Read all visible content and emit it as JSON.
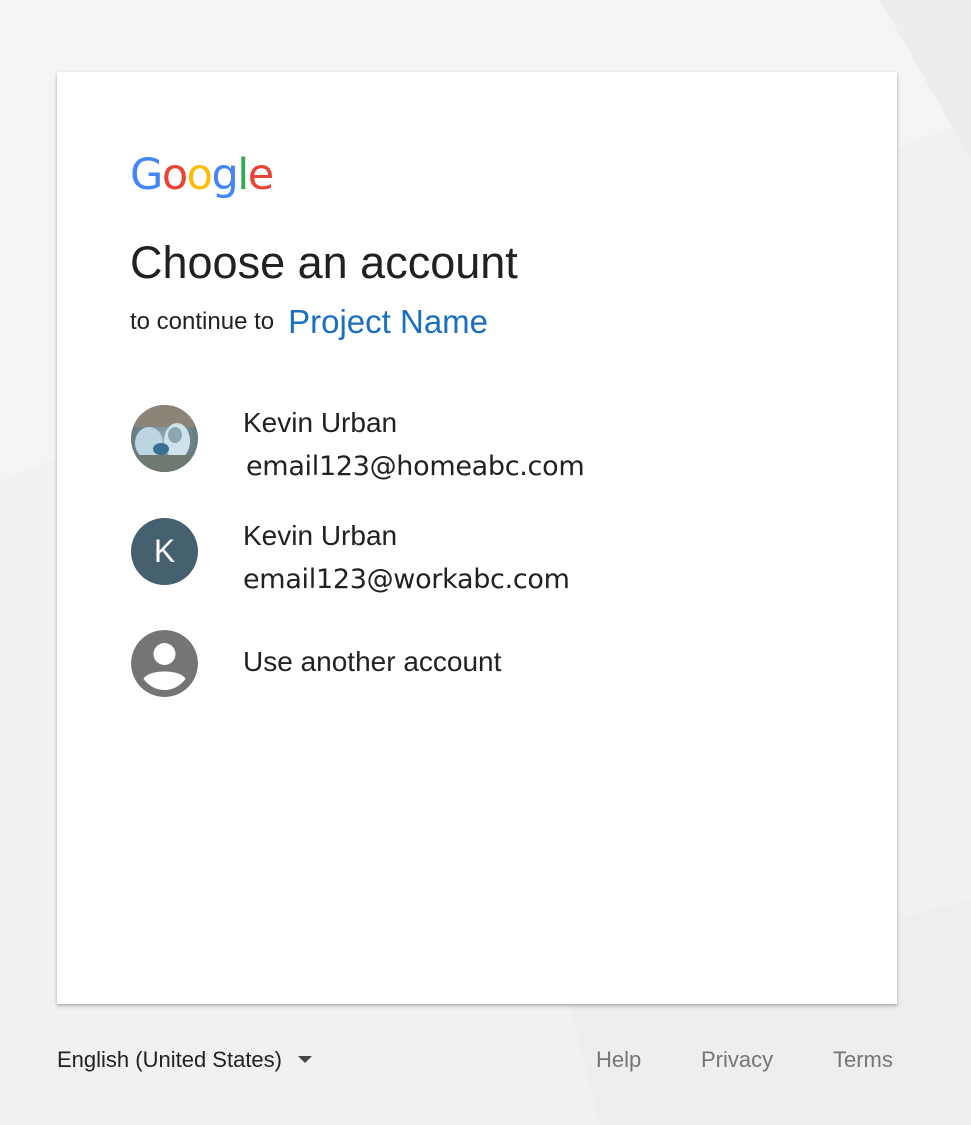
{
  "logo": {
    "letters": [
      {
        "ch": "G",
        "color": "#4285F4"
      },
      {
        "ch": "o",
        "color": "#EA4335"
      },
      {
        "ch": "o",
        "color": "#FBBC05"
      },
      {
        "ch": "g",
        "color": "#4285F4"
      },
      {
        "ch": "l",
        "color": "#34A853"
      },
      {
        "ch": "e",
        "color": "#EA4335"
      }
    ]
  },
  "dialog": {
    "title": "Choose an account",
    "subtitle_prefix": "to continue to",
    "project_name": "Project Name"
  },
  "accounts": [
    {
      "name": "Kevin Urban",
      "email": "email123@homeabc.com",
      "avatar": "photo-avatar"
    },
    {
      "name": "Kevin Urban",
      "email": "email123@workabc.com",
      "avatar": "initial-avatar",
      "initial": "K",
      "avatar_color": "#45606E"
    }
  ],
  "other_account": {
    "label": "Use another account",
    "icon": "account-circle-icon"
  },
  "footer": {
    "language": "English (United States)",
    "links": [
      "Help",
      "Privacy",
      "Terms"
    ]
  },
  "colors": {
    "link": "#1A6FBF",
    "avatar_dark": "#45606E",
    "background": "#F1F1F1"
  }
}
